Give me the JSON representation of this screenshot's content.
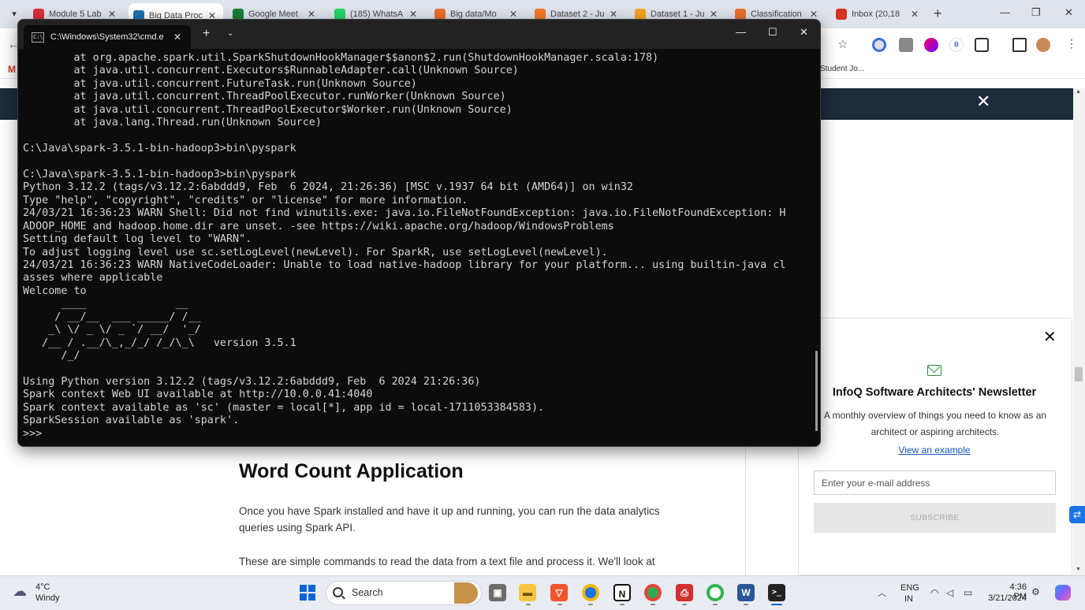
{
  "browser": {
    "tabs": [
      {
        "title": "Module 5 Lab",
        "color": "#d9303a"
      },
      {
        "title": "Big Data Proc",
        "color": "#1f6fb2"
      },
      {
        "title": "Google Meet",
        "color": "#188038"
      },
      {
        "title": "(185) WhatsA",
        "color": "#25d366"
      },
      {
        "title": "Big data/Mo",
        "color": "#e8702a"
      },
      {
        "title": "Dataset 2 - Ju",
        "color": "#f37626"
      },
      {
        "title": "Dataset 1 - Ju",
        "color": "#f5a623"
      },
      {
        "title": "Classification",
        "color": "#e8702a"
      },
      {
        "title": "Inbox (20,18",
        "color": "#d93025"
      }
    ],
    "bookmark_label": "Student Jo..."
  },
  "terminal": {
    "title": "C:\\Windows\\System32\\cmd.e",
    "lines": [
      "        at org.apache.spark.util.SparkShutdownHookManager$$anon$2.run(ShutdownHookManager.scala:178)",
      "        at java.util.concurrent.Executors$RunnableAdapter.call(Unknown Source)",
      "        at java.util.concurrent.FutureTask.run(Unknown Source)",
      "        at java.util.concurrent.ThreadPoolExecutor.runWorker(Unknown Source)",
      "        at java.util.concurrent.ThreadPoolExecutor$Worker.run(Unknown Source)",
      "        at java.lang.Thread.run(Unknown Source)",
      "",
      "C:\\Java\\spark-3.5.1-bin-hadoop3>bin\\pyspark",
      "",
      "C:\\Java\\spark-3.5.1-bin-hadoop3>bin\\pyspark",
      "Python 3.12.2 (tags/v3.12.2:6abddd9, Feb  6 2024, 21:26:36) [MSC v.1937 64 bit (AMD64)] on win32",
      "Type \"help\", \"copyright\", \"credits\" or \"license\" for more information.",
      "24/03/21 16:36:23 WARN Shell: Did not find winutils.exe: java.io.FileNotFoundException: java.io.FileNotFoundException: H",
      "ADOOP_HOME and hadoop.home.dir are unset. -see https://wiki.apache.org/hadoop/WindowsProblems",
      "Setting default log level to \"WARN\".",
      "To adjust logging level use sc.setLogLevel(newLevel). For SparkR, use setLogLevel(newLevel).",
      "24/03/21 16:36:23 WARN NativeCodeLoader: Unable to load native-hadoop library for your platform... using builtin-java cl",
      "asses where applicable",
      "Welcome to",
      "      ____              __",
      "     / __/__  ___ _____/ /__",
      "    _\\ \\/ _ \\/ _ `/ __/  '_/",
      "   /__ / .__/\\_,_/_/ /_/\\_\\   version 3.5.1",
      "      /_/",
      "",
      "Using Python version 3.12.2 (tags/v3.12.2:6abddd9, Feb  6 2024 21:26:36)",
      "Spark context Web UI available at http://10.0.0.41:4040",
      "Spark context available as 'sc' (master = local[*], app id = local-1711053384583).",
      "SparkSession available as 'spark'.",
      ">>> "
    ]
  },
  "article": {
    "heading": "Word Count Application",
    "para1": "Once you have Spark installed and have it up and running, you can run the data analytics queries using Spark API.",
    "para2": "These are simple commands to read the data from a text file and process it. We'll look at"
  },
  "newsletter": {
    "title": "InfoQ Software Architects' Newsletter",
    "description": "A monthly overview of things you need to know as an architect or aspiring architects.",
    "link": "View an example",
    "email_placeholder": "Enter your e-mail address",
    "subscribe": "SUBSCRIBE"
  },
  "taskbar": {
    "weather_temp": "4°C",
    "weather_desc": "Windy",
    "search_label": "Search",
    "lang_line1": "ENG",
    "lang_line2": "IN",
    "time": "4:36 PM",
    "date": "3/21/2024"
  }
}
